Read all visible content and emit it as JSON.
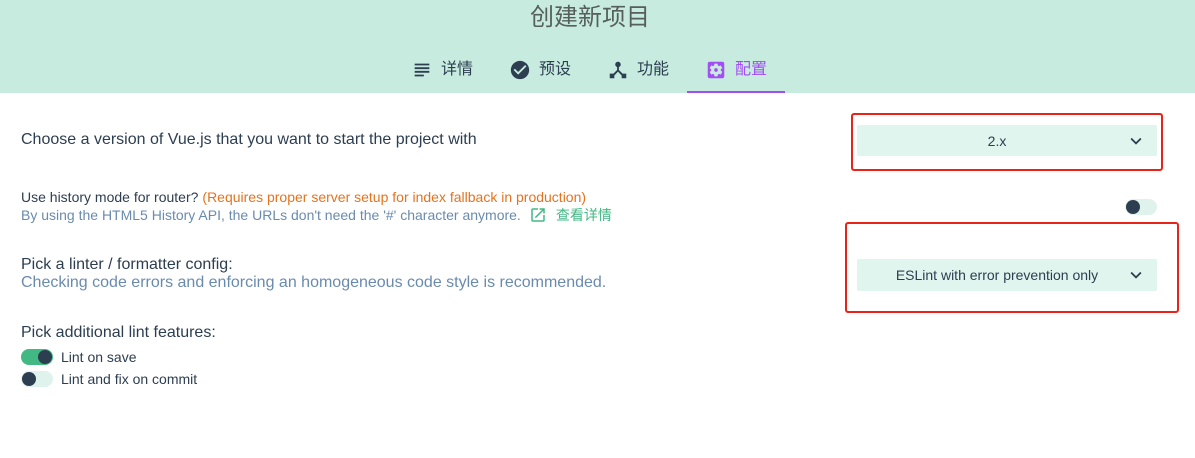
{
  "colors": {
    "header_bg": "#c7ebdf",
    "primary_text": "#2c3e50",
    "title_text": "#565f5c",
    "accent_purple": "#a44cf6",
    "vue_green": "#42b983",
    "warning_orange": "#e3731f",
    "description_blue": "#6a8bad",
    "field_bg": "#e0f5ee",
    "toggle_track_off": "#dff3ec",
    "annotation_red": "#e8231a"
  },
  "header": {
    "title": "创建新项目",
    "tabs": [
      {
        "label": "详情",
        "icon": "subject-icon",
        "active": false
      },
      {
        "label": "预设",
        "icon": "check-circle-icon",
        "active": false
      },
      {
        "label": "功能",
        "icon": "device-hub-icon",
        "active": false
      },
      {
        "label": "配置",
        "icon": "settings-applications-icon",
        "active": true
      }
    ]
  },
  "prompts": {
    "vue_version": {
      "label": "Choose a version of Vue.js that you want to start the project with",
      "selected": "2.x",
      "dropdown_icon": "chevron-down-icon"
    },
    "history_mode": {
      "label": "Use history mode for router?",
      "warning": "(Requires proper server setup for index fallback in production)",
      "description": "By using the HTML5 History API, the URLs don't need the '#' character anymore.",
      "link_label": "查看详情",
      "link_icon": "open-in-new-icon",
      "enabled": false
    },
    "linter_config": {
      "label": "Pick a linter / formatter config:",
      "description": "Checking code errors and enforcing an homogeneous code style is recommended.",
      "selected": "ESLint with error prevention only",
      "dropdown_icon": "chevron-down-icon"
    },
    "lint_features": {
      "label": "Pick additional lint features:",
      "options": [
        {
          "label": "Lint on save",
          "enabled": true
        },
        {
          "label": "Lint and fix on commit",
          "enabled": false
        }
      ]
    }
  }
}
